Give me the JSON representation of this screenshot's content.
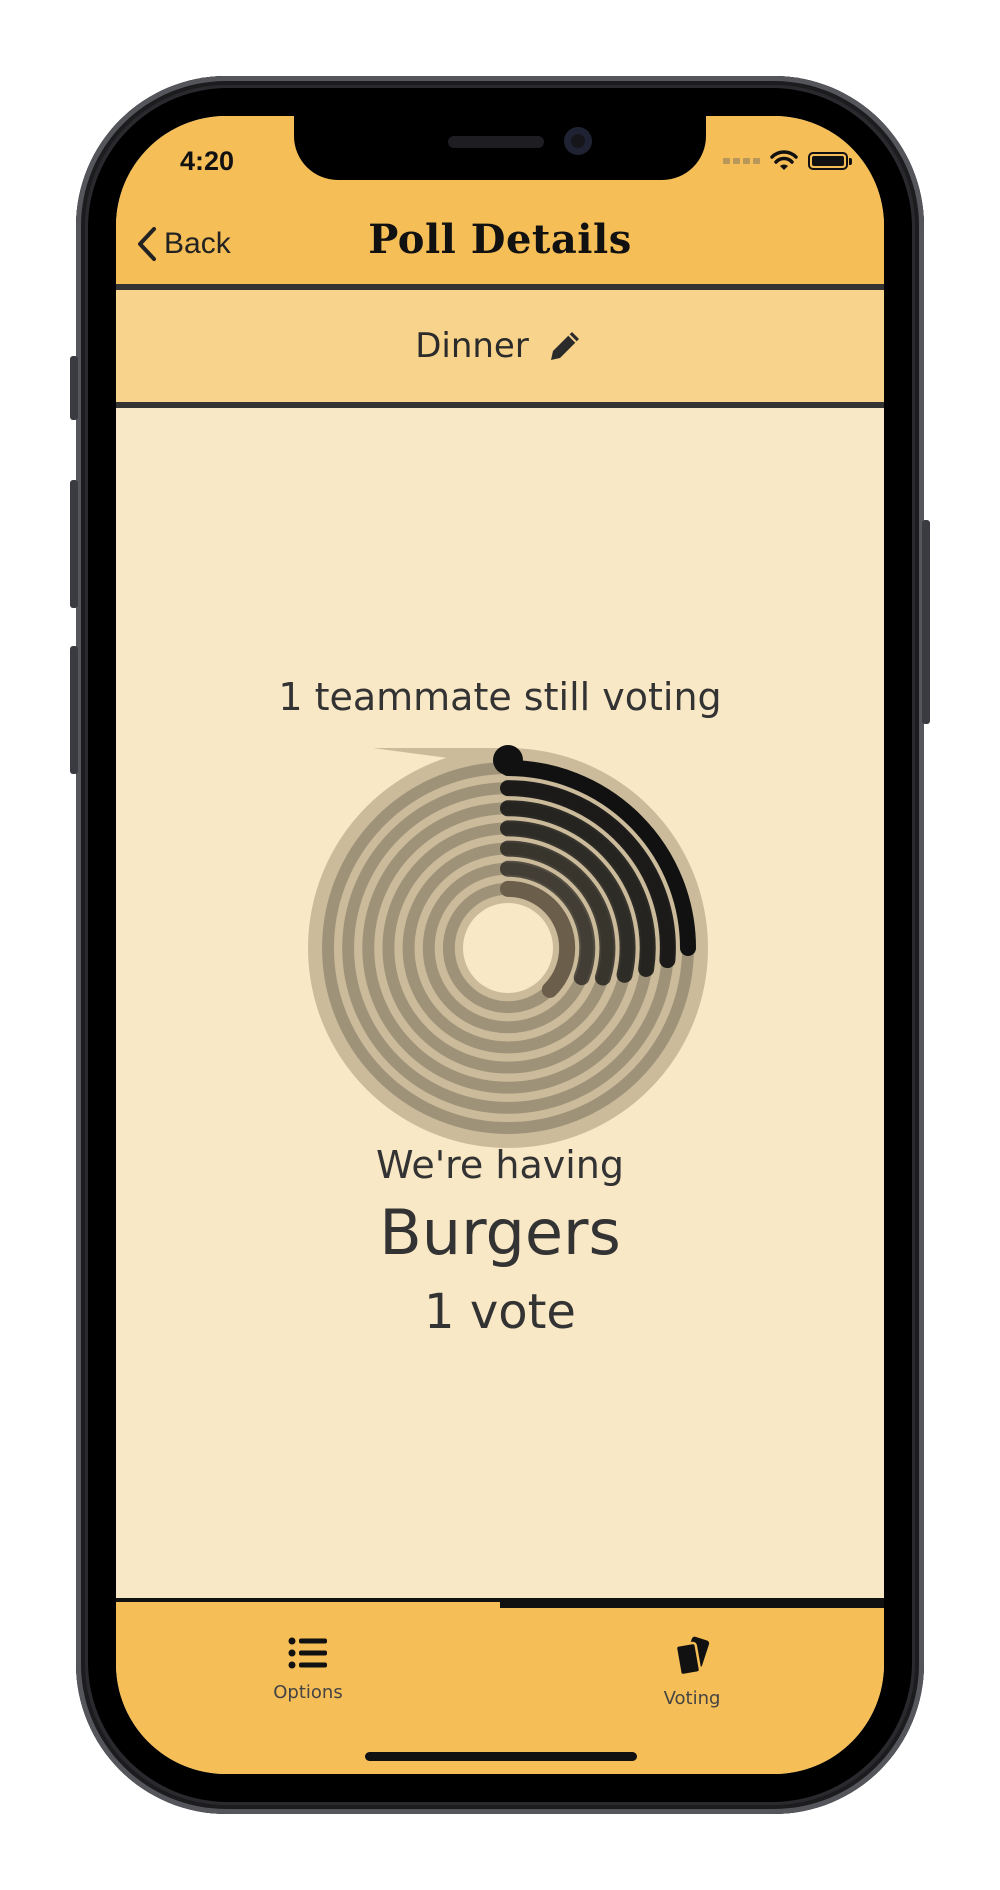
{
  "status_bar": {
    "time": "4:20",
    "wifi_icon": "wifi-icon",
    "battery_icon": "battery-icon",
    "battery_level": 1.0
  },
  "header": {
    "back_label": "Back",
    "title": "Poll Details"
  },
  "poll": {
    "name": "Dinner",
    "edit_icon": "pencil-icon"
  },
  "results": {
    "still_voting_text": "1 teammate still voting",
    "intro_text": "We're having",
    "winner": "Burgers",
    "vote_count_text": "1 vote",
    "rings": {
      "count": 7,
      "dark_ring_progress": 0.25,
      "inner_ring_progress": 0.375,
      "colors": {
        "track": "#9e9278",
        "outer_track": "#cbbb9b",
        "progress": "#111111",
        "background": "#f9e8c6"
      }
    }
  },
  "tabs": [
    {
      "label": "Options",
      "icon": "list-icon",
      "active": false
    },
    {
      "label": "Voting",
      "icon": "cards-icon",
      "active": true
    }
  ],
  "colors": {
    "accent": "#f5be57",
    "subheader": "#f8d38b",
    "content_bg": "#f9e8c6",
    "divider": "#333333"
  }
}
